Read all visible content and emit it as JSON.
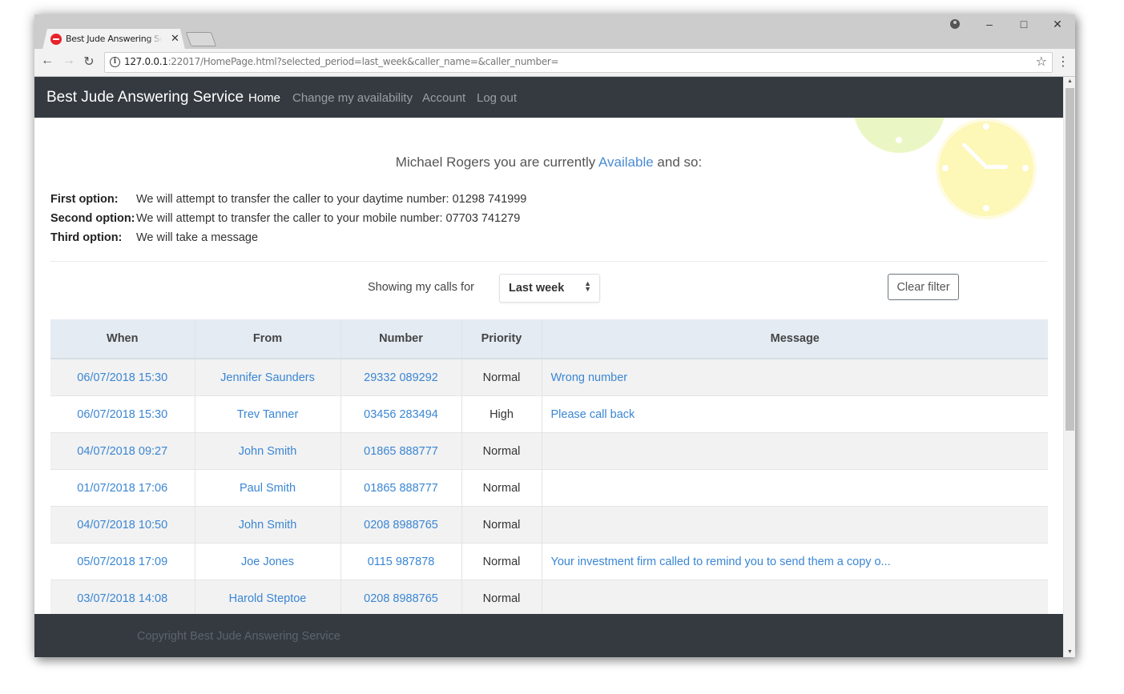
{
  "browser": {
    "tab_title": "Best Jude Answering Service",
    "url_host": "127.0.0.1",
    "url_rest": ":22017/HomePage.html?selected_period=last_week&caller_name=&caller_number=",
    "icons": {
      "back": "←",
      "forward": "→",
      "reload": "↻",
      "info": "i",
      "star": "☆",
      "menu": "⋮",
      "close_tab": "✕",
      "minimize": "–",
      "maximize": "□",
      "close": "✕",
      "scroll_up": "▲",
      "scroll_down": "▼"
    }
  },
  "navbar": {
    "brand": "Best Jude Answering Service",
    "links": [
      {
        "label": "Home",
        "active": true
      },
      {
        "label": "Change my availability",
        "active": false
      },
      {
        "label": "Account",
        "active": false
      },
      {
        "label": "Log out",
        "active": false
      }
    ]
  },
  "availability": {
    "prefix": "Michael Rogers you are currently ",
    "status": "Available",
    "suffix": " and so:"
  },
  "options": [
    {
      "label": "First option:",
      "text": "We will attempt to transfer the caller to your daytime number: 01298 741999"
    },
    {
      "label": "Second option:",
      "text": "We will attempt to transfer the caller to your mobile number: 07703 741279"
    },
    {
      "label": "Third option:",
      "text": "We will take a message"
    }
  ],
  "filter": {
    "label": "Showing my calls for",
    "selected_period": "Last week",
    "arrows": "▲▼",
    "clear_label": "Clear filter"
  },
  "calls_table": {
    "columns": [
      "When",
      "From",
      "Number",
      "Priority",
      "Message"
    ],
    "rows": [
      {
        "when": "06/07/2018 15:30",
        "from": "Jennifer Saunders",
        "number": "29332 089292",
        "priority": "Normal",
        "message": "Wrong number"
      },
      {
        "when": "06/07/2018 15:30",
        "from": "Trev Tanner",
        "number": "03456 283494",
        "priority": "High",
        "message": "Please call back"
      },
      {
        "when": "04/07/2018 09:27",
        "from": "John Smith",
        "number": "01865 888777",
        "priority": "Normal",
        "message": ""
      },
      {
        "when": "01/07/2018 17:06",
        "from": "Paul Smith",
        "number": "01865 888777",
        "priority": "Normal",
        "message": ""
      },
      {
        "when": "04/07/2018 10:50",
        "from": "John Smith",
        "number": "0208 8988765",
        "priority": "Normal",
        "message": ""
      },
      {
        "when": "05/07/2018 17:09",
        "from": "Joe Jones",
        "number": "0115 987878",
        "priority": "Normal",
        "message": "Your investment firm called to remind you to send them a copy o..."
      },
      {
        "when": "03/07/2018 14:08",
        "from": "Harold Steptoe",
        "number": "0208 8988765",
        "priority": "Normal",
        "message": ""
      }
    ]
  },
  "footer": {
    "text": "Copyright Best Jude Answering Service"
  },
  "colors": {
    "navbar_bg": "#343a40",
    "link": "#3a86d3",
    "available": "#4a8bd6",
    "table_header_bg": "#e4ebf3",
    "stripe": "#f2f2f2"
  }
}
